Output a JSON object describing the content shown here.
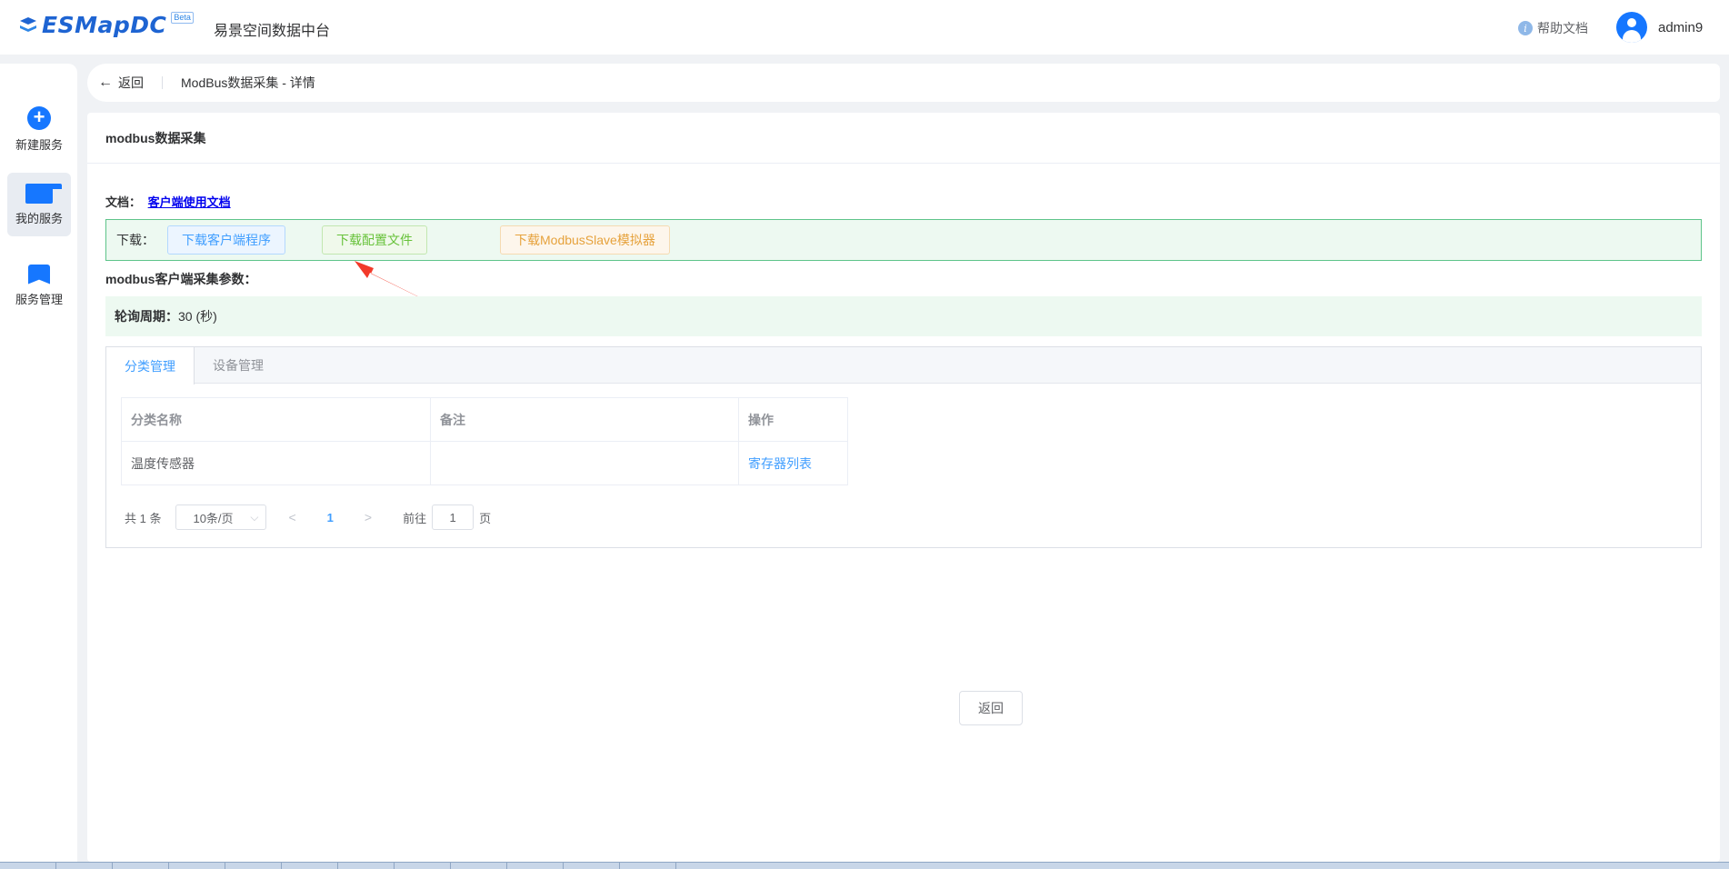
{
  "header": {
    "logo_text": "ESMapDC",
    "beta_badge": "Beta",
    "platform_name": "易景空间数据中台",
    "help_label": "帮助文档",
    "username": "admin9"
  },
  "sidebar": {
    "items": [
      {
        "label": "新建服务",
        "icon": "plus-circle-icon"
      },
      {
        "label": "我的服务",
        "icon": "folder-icon"
      },
      {
        "label": "服务管理",
        "icon": "bookmark-icon"
      }
    ]
  },
  "breadcrumb": {
    "back_label": "返回",
    "title": "ModBus数据采集 - 详情"
  },
  "card": {
    "title": "modbus数据采集",
    "doc_label": "文档：",
    "doc_link": "客户端使用文档",
    "download_label": "下载：",
    "download_buttons": [
      {
        "label": "下载客户端程序",
        "color": "#409eff"
      },
      {
        "label": "下载配置文件",
        "color": "#67c23a"
      },
      {
        "label": "下载ModbusSlave模拟器",
        "color": "#e6a23c"
      }
    ],
    "params_title": "modbus客户端采集参数：",
    "poll_label": "轮询周期：",
    "poll_value": "30 (秒)"
  },
  "tabs": [
    {
      "label": "分类管理",
      "active": true
    },
    {
      "label": "设备管理",
      "active": false
    }
  ],
  "table": {
    "columns": [
      "分类名称",
      "备注",
      "操作"
    ],
    "rows": [
      {
        "name": "温度传感器",
        "remark": "",
        "action": "寄存器列表"
      }
    ]
  },
  "pagination": {
    "total": "共 1 条",
    "page_size": "10条/页",
    "current_page": "1",
    "goto_label": "前往",
    "goto_value": "1",
    "page_suffix": "页"
  },
  "footer": {
    "return_label": "返回"
  },
  "annotation": {
    "arrow_color": "#f23a2a"
  }
}
